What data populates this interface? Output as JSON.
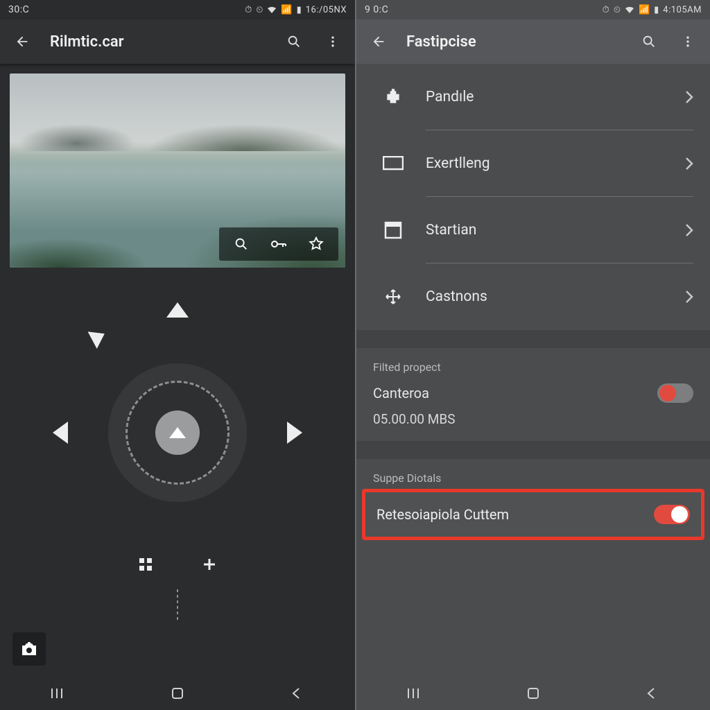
{
  "left": {
    "status": {
      "left": "30:C",
      "right": "16:/05NX"
    },
    "app_title": "Rilmtic.car",
    "preview_actions": [
      "zoom",
      "key",
      "star"
    ]
  },
  "right": {
    "status": {
      "left": "9 0:C",
      "right": "4:105AM"
    },
    "app_title": "Fastipcise",
    "menu": [
      {
        "icon": "puzzle",
        "label": "Pandıle"
      },
      {
        "icon": "display",
        "label": "Exertlleng"
      },
      {
        "icon": "window",
        "label": "Startian"
      },
      {
        "icon": "move",
        "label": "Castnons"
      }
    ],
    "section1": {
      "title": "Filted propect",
      "row_label": "Canteroa",
      "value": "05.00.00 MBS"
    },
    "section2": {
      "title": "Suppe Diotals",
      "row_label": "Retesoiapiola Cuttem"
    }
  }
}
